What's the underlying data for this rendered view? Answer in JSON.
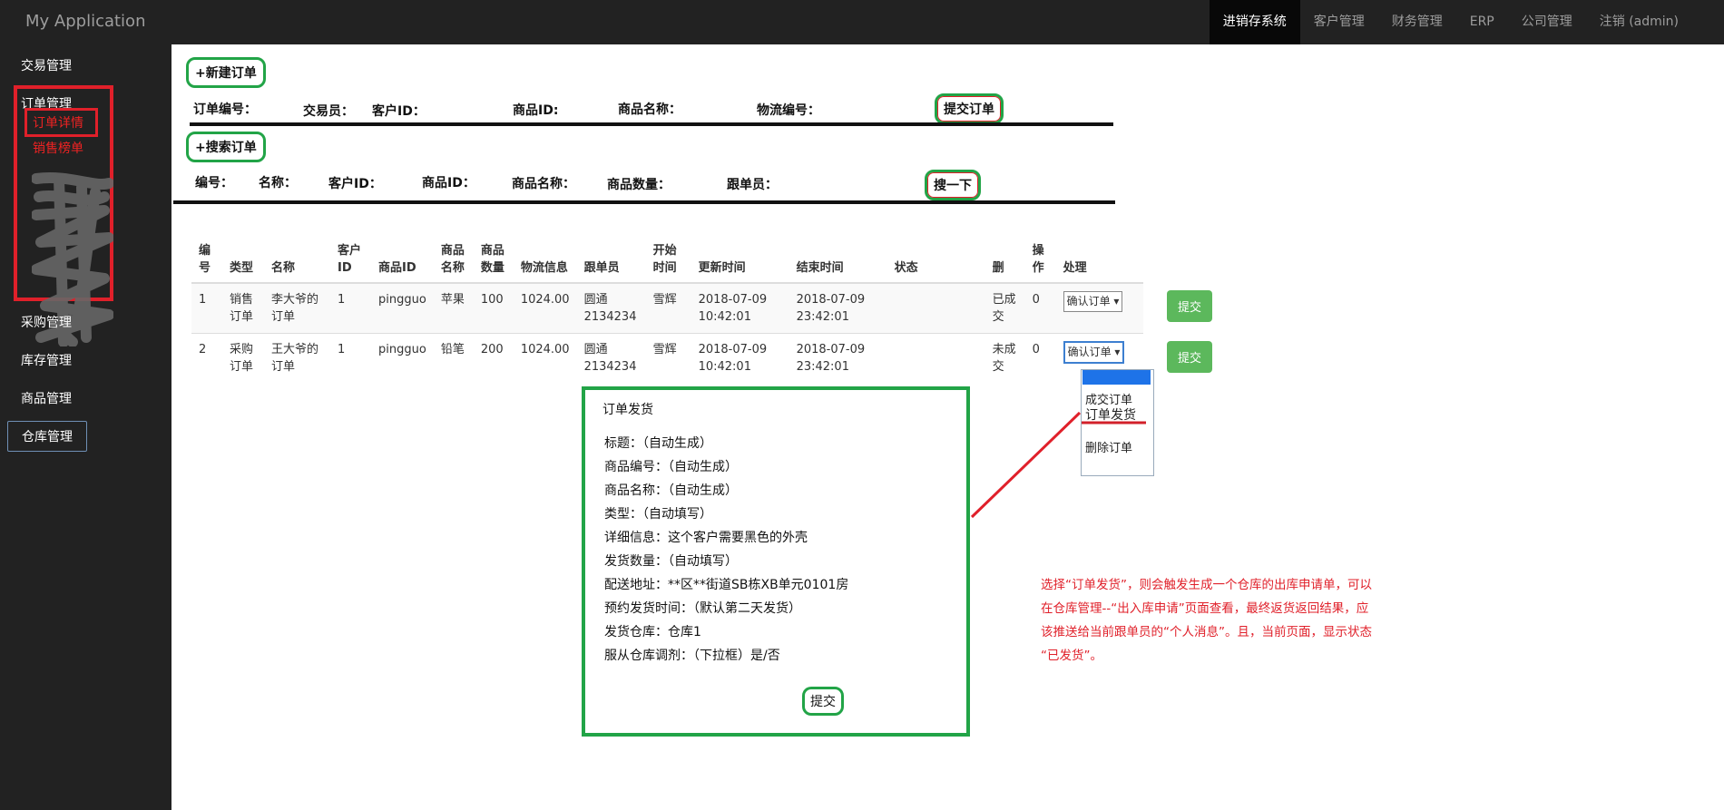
{
  "app": {
    "brand": "My Application"
  },
  "topnav": [
    {
      "label": "进销存系统",
      "active": true
    },
    {
      "label": "客户管理"
    },
    {
      "label": "财务管理"
    },
    {
      "label": "ERP"
    },
    {
      "label": "公司管理"
    },
    {
      "label": "注销 (admin)"
    }
  ],
  "sidebar": {
    "trade": "交易管理",
    "order": "订单管理",
    "order_detail": "订单详情",
    "sales_ranking": "销售榜单",
    "purchase": "采购管理",
    "inventory": "库存管理",
    "product": "商品管理",
    "warehouse": "仓库管理"
  },
  "new_order": {
    "button": "+新建订单",
    "fields": [
      "订单编号：",
      "交易员：",
      "客户ID：",
      "商品ID:",
      "商品名称：",
      "物流编号："
    ],
    "submit": "提交订单"
  },
  "search_order": {
    "button": "+搜索订单",
    "fields": [
      "编号：",
      "名称：",
      "客户ID：",
      "商品ID：",
      "商品名称：",
      "商品数量：",
      "跟单员："
    ],
    "submit": "搜一下"
  },
  "table": {
    "headers": [
      "编号",
      "类型",
      "名称",
      "客户ID",
      "商品ID",
      "商品名称",
      "商品数量",
      "物流信息",
      "跟单员",
      "开始时间",
      "更新时间",
      "结束时间",
      "状态",
      "删",
      "操作",
      "处理"
    ],
    "rows": [
      {
        "id": "1",
        "type": "销售订单",
        "name": "李大爷的订单",
        "customer_id": "1",
        "product_id": "pingguo",
        "product_name": "苹果",
        "qty": "100",
        "logistics": "1024.00",
        "tracker": "圆通2134234",
        "start": "雪辉",
        "updated": "2018-07-09 10:42:01",
        "ended": "2018-07-09 23:42:01",
        "status": "",
        "deleted": "已成交",
        "op": "0",
        "action": "确认订单"
      },
      {
        "id": "2",
        "type": "采购订单",
        "name": "王大爷的订单",
        "customer_id": "1",
        "product_id": "pingguo",
        "product_name": "铅笔",
        "qty": "200",
        "logistics": "1024.00",
        "tracker": "圆通2134234",
        "start": "雪辉",
        "updated": "2018-07-09 10:42:01",
        "ended": "2018-07-09 23:42:01",
        "status": "",
        "deleted": "未成交",
        "op": "0",
        "action": "确认订单"
      }
    ],
    "submit_label": "提交"
  },
  "dropdown": {
    "options": [
      "成交订单",
      "订单发货",
      "删除订单"
    ]
  },
  "modal": {
    "title": "订单发货",
    "lines": [
      "标题：（自动生成）",
      "商品编号：（自动生成）",
      "商品名称：（自动生成）",
      "类型：（自动填写）",
      "详细信息：这个客户需要黑色的外壳",
      "发货数量：（自动填写）",
      "配送地址：**区**街道SB栋XB单元0101房",
      "预约发货时间：（默认第二天发货）",
      "发货仓库：仓库1",
      "服从仓库调剂：（下拉框）是/否"
    ],
    "submit": "提交"
  },
  "annotation": {
    "lines": [
      "选择“订单发货”，则会触发生成一个仓库的出库申请单，可以",
      "在仓库管理--“出入库申请”页面查看，最终返货返回结果，应",
      "该推送给当前跟单员的“个人消息”。且，当前页面，显示状态",
      "“已发货”。"
    ]
  },
  "colors": {
    "accent_green": "#22a447",
    "annotation_red": "#e0202a",
    "navbar": "#222222",
    "success_button": "#5cb85c"
  }
}
